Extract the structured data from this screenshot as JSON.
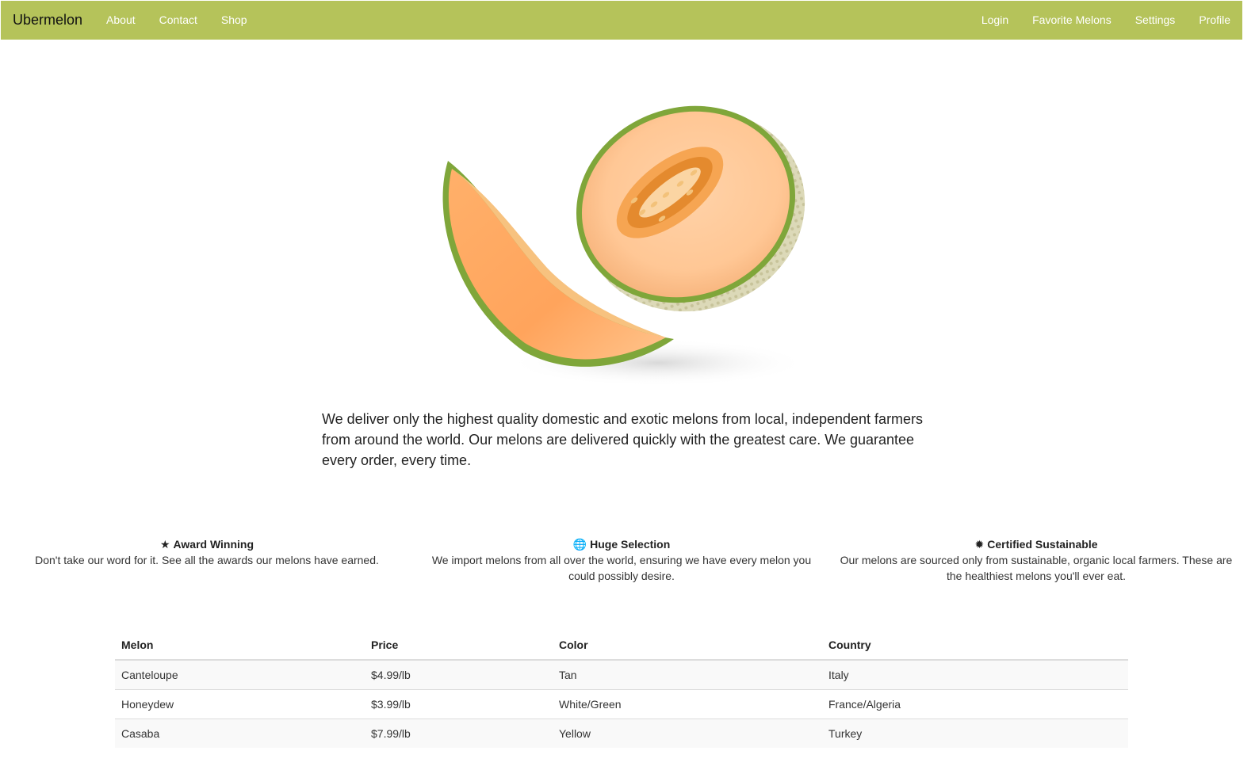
{
  "navbar": {
    "brand": "Ubermelon",
    "left_links": [
      "About",
      "Contact",
      "Shop"
    ],
    "right_links": [
      "Login",
      "Favorite Melons",
      "Settings",
      "Profile"
    ],
    "bg_color": "#b5c35a"
  },
  "intro": {
    "text": "We deliver only the highest quality domestic and exotic melons from local, independent farmers from around the world. Our melons are delivered quickly with the greatest care. We guarantee every order, every time."
  },
  "features": [
    {
      "icon": "star-icon",
      "glyph": "★",
      "title": "Award Winning",
      "desc": "Don't take our word for it. See all the awards our melons have earned."
    },
    {
      "icon": "globe-icon",
      "glyph": "🌐",
      "title": "Huge Selection",
      "desc": "We import melons from all over the world, ensuring we have every melon you could possibly desire."
    },
    {
      "icon": "certificate-icon",
      "glyph": "✹",
      "title": "Certified Sustainable",
      "desc": "Our melons are sourced only from sustainable, organic local farmers. These are the healthiest melons you'll ever eat."
    }
  ],
  "table": {
    "headers": [
      "Melon",
      "Price",
      "Color",
      "Country"
    ],
    "rows": [
      [
        "Canteloupe",
        "$4.99/lb",
        "Tan",
        "Italy"
      ],
      [
        "Honeydew",
        "$3.99/lb",
        "White/Green",
        "France/Algeria"
      ],
      [
        "Casaba",
        "$7.99/lb",
        "Yellow",
        "Turkey"
      ]
    ]
  }
}
